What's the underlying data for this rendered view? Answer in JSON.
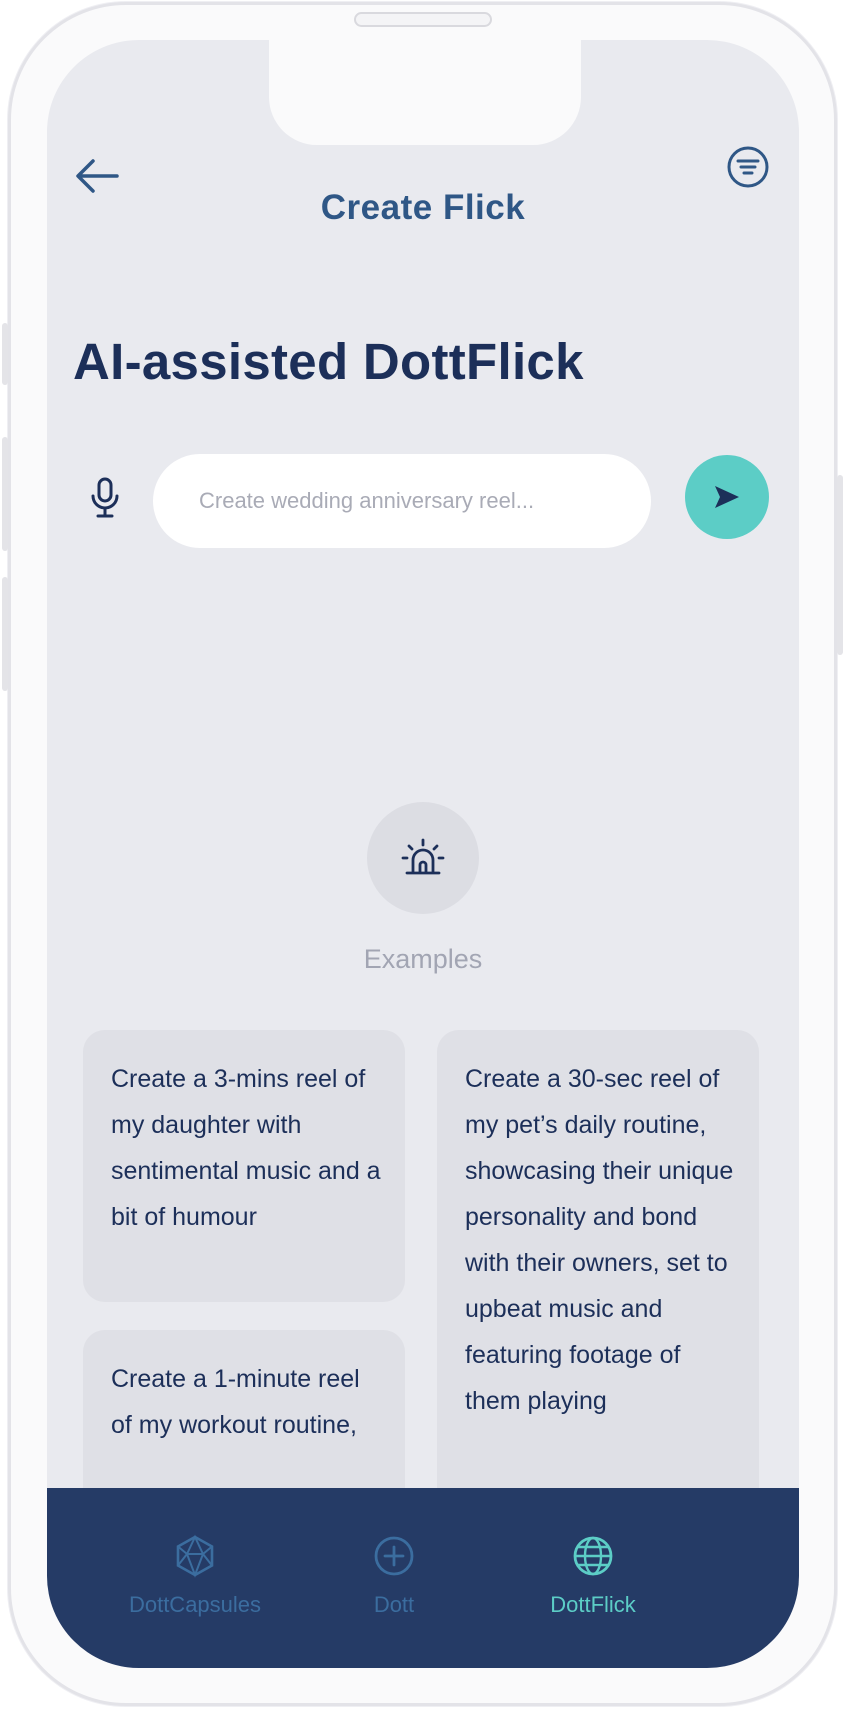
{
  "header": {
    "title": "Create Flick",
    "back_icon": "arrow-left-icon",
    "filter_icon": "filter-lines-icon"
  },
  "main": {
    "title": "AI-assisted DottFlick",
    "search": {
      "placeholder": "Create wedding anniversary reel...",
      "value": ""
    },
    "mic_icon": "microphone-icon",
    "send_icon": "send-icon",
    "examples": {
      "icon": "alarm-light-icon",
      "label": "Examples",
      "cards": [
        "Create a 3-mins reel of my daughter with  sentimental music and a bit of humour",
        "Create a 30-sec reel of my pet’s daily routine, showcasing their unique personality and bond with their owners, set to upbeat music and featuring footage of them playing",
        "Create a 1-minute reel of my workout routine,"
      ]
    }
  },
  "bottom_nav": {
    "items": [
      {
        "label": "DottCapsules",
        "icon": "hexagon-icon",
        "active": false
      },
      {
        "label": "Dott",
        "icon": "plus-circle-icon",
        "active": false
      },
      {
        "label": "DottFlick",
        "icon": "globe-icon",
        "active": true
      }
    ]
  },
  "colors": {
    "accent": "#5ccdc6",
    "navy": "#1c2f59",
    "nav_bg": "#253b66",
    "screen_bg": "#e9eaef"
  }
}
